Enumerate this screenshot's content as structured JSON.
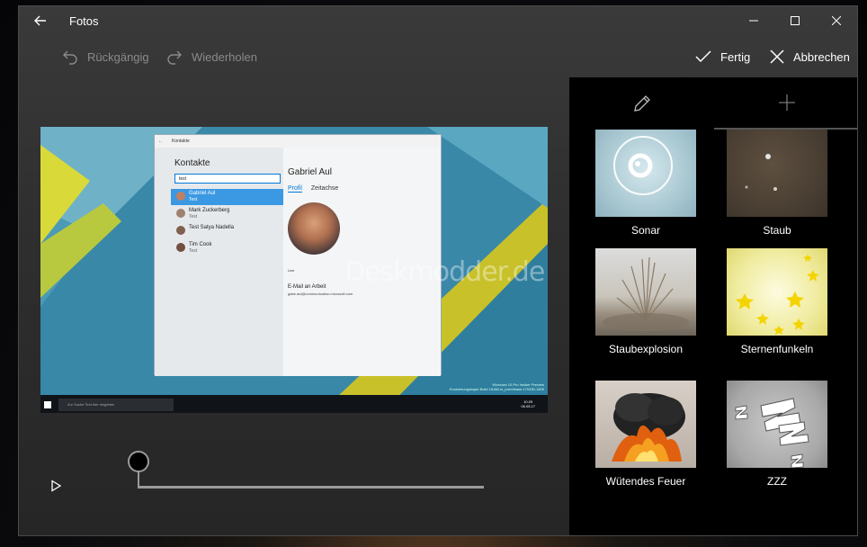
{
  "window": {
    "title": "Fotos"
  },
  "toolbar": {
    "undo_label": "Rückgängig",
    "redo_label": "Wiederholen",
    "done_label": "Fertig",
    "cancel_label": "Abbrechen"
  },
  "panel": {
    "tabs": [
      {
        "icon": "pencil-icon"
      },
      {
        "icon": "plus-icon"
      }
    ],
    "effects": [
      {
        "label": "Sonar"
      },
      {
        "label": "Staub"
      },
      {
        "label": "Staubexplosion"
      },
      {
        "label": "Sternenfunkeln"
      },
      {
        "label": "Wütendes Feuer"
      },
      {
        "label": "ZZZ"
      }
    ]
  },
  "preview": {
    "contacts_title": "Kontakte",
    "window_caption": "Kontakte",
    "search_value": "test",
    "contacts": [
      {
        "name": "Gabriel Aul",
        "sub": "Test"
      },
      {
        "name": "Mark Zuckerberg",
        "sub": "Test"
      },
      {
        "name": "Test Satya Nadella",
        "sub": ""
      },
      {
        "name": "Tim Cook",
        "sub": "Test"
      }
    ],
    "detail_name": "Gabriel Aul",
    "tab_profile": "Profil",
    "tab_timeline": "Zeitachse",
    "live_label": "Live",
    "email_label": "E-Mail an Arbeit",
    "email_value": "gabe.aul@communication.microsoft.com",
    "watermark": "Deskmodder.de",
    "taskbar_search": "Zur Suche Text hier eingeben",
    "time": "10:29",
    "date": "06.05.17",
    "build_line1": "Windows 10 Pro Insider Preview",
    "build_line2": "Evaluierungskopie Build 16188.rs_prerelease.170430-1609"
  },
  "colors": {
    "accent": "#0078d7",
    "panel_bg": "#000000",
    "window_bg": "#2f2f2f"
  }
}
